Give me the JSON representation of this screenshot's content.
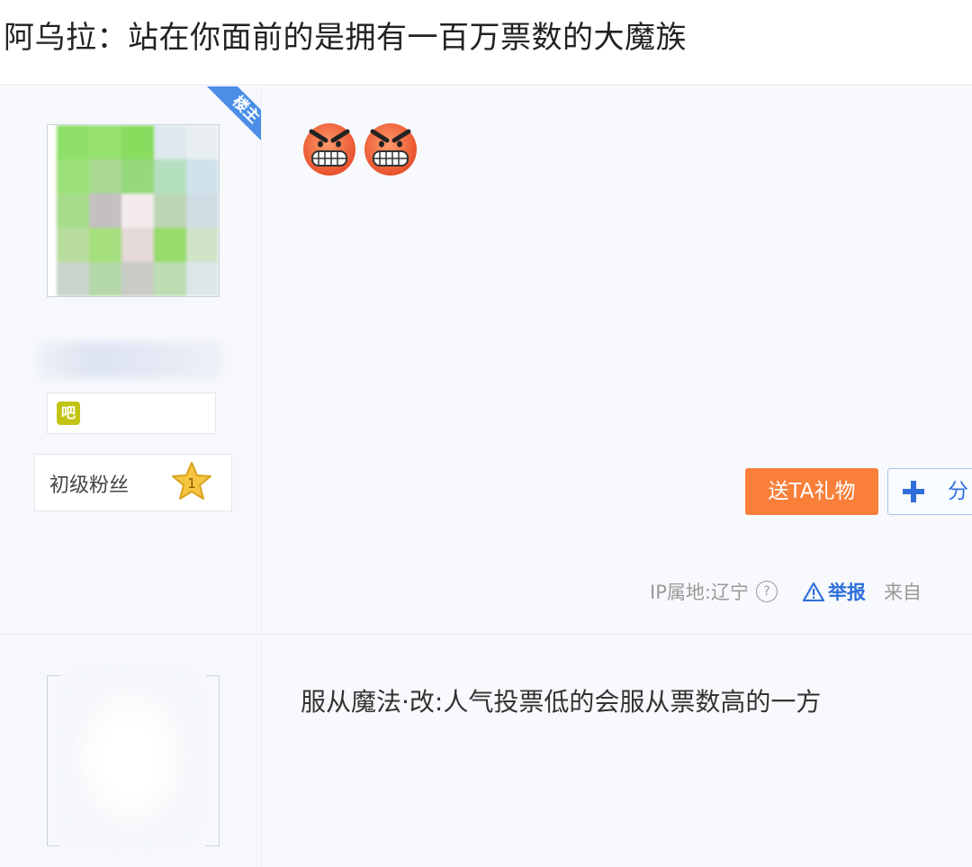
{
  "thread": {
    "title": "阿乌拉：站在你面前的是拥有一百万票数的大魔族"
  },
  "post1": {
    "badge": "楼主",
    "level_icon": "吧",
    "fan_level": "初级粉丝",
    "fan_level_number": "1",
    "content_emojis": [
      "angry-face-icon",
      "angry-face-icon"
    ],
    "gift_button": "送TA礼物",
    "share_button": "分",
    "ip_location": "IP属地:辽宁",
    "help_glyph": "?",
    "report": "举报",
    "from": "来自"
  },
  "post2": {
    "content": "服从魔法·改:人气投票低的会服从票数高的一方"
  },
  "colors": {
    "gift_button": "#f97f3a",
    "link_blue": "#2f6fdb",
    "badge_blue": "#4a8ee8"
  }
}
